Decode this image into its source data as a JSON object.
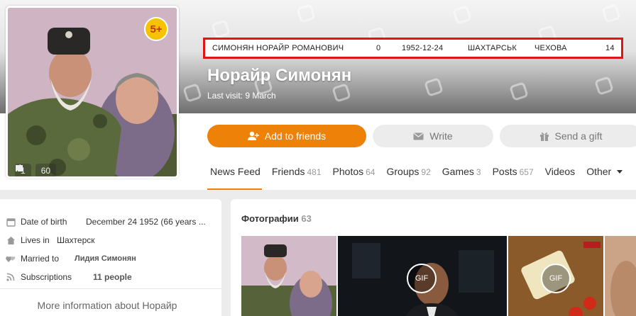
{
  "info_bar": {
    "full_name": "СИМОНЯН НОРАЙР РОМАНОВИЧ",
    "zero": "0",
    "date": "1952-12-24",
    "city": "ШАХТАРСЬК",
    "street": "ЧЕХОВА",
    "number": "14"
  },
  "profile": {
    "name": "Норайр Симонян",
    "last_visit": "Last visit: 9 March",
    "age_badge": "5+",
    "comments_count": "1",
    "likes_count": "60"
  },
  "actions": {
    "add_friends": "Add to friends",
    "write": "Write",
    "gift": "Send a gift"
  },
  "nav": [
    {
      "label": "News Feed",
      "count": ""
    },
    {
      "label": "Friends",
      "count": "481"
    },
    {
      "label": "Photos",
      "count": "64"
    },
    {
      "label": "Groups",
      "count": "92"
    },
    {
      "label": "Games",
      "count": "3"
    },
    {
      "label": "Posts",
      "count": "657"
    },
    {
      "label": "Videos",
      "count": ""
    },
    {
      "label": "Other",
      "count": ""
    }
  ],
  "info": {
    "dob_label": "Date of birth",
    "dob_value": "December 24 1952 (66 years ...",
    "lives_label": "Lives in",
    "lives_value": "Шахтерск",
    "married_label": "Married to",
    "married_value": "Лидия Симонян",
    "subs_label": "Subscriptions",
    "subs_value": "11 people",
    "more": "More information about Норайр"
  },
  "photos": {
    "title": "Фотографии",
    "count": "63",
    "gif_label": "GIF"
  },
  "colors": {
    "accent": "#ee8208",
    "info_bar_border": "#e01616",
    "badge": "#f7c300"
  }
}
